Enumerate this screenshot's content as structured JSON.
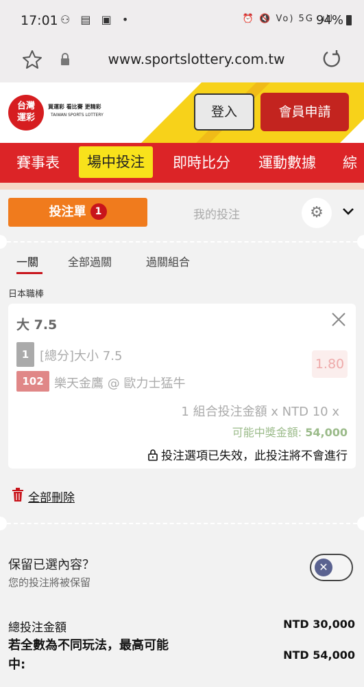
{
  "status_bar": {
    "time": "17:01",
    "left_icons": "⚇ ▤ ▣ •",
    "right_icons": "⏰ 🔇 Vo) 5G .ıll",
    "battery": "94%"
  },
  "browser": {
    "url": "www.sportslottery.com.tw"
  },
  "header": {
    "logo_text": "台灣\n運彩",
    "logo_tagline": "買運彩 看比賽 更精彩",
    "logo_en": "TAIWAN SPORTS LOTTERY",
    "login_label": "登入",
    "register_label": "會員申請",
    "colors": {
      "brand_red": "#dc2427",
      "yellow": "#f8e21b"
    }
  },
  "nav": {
    "items": [
      {
        "label": "賽事表"
      },
      {
        "label": "場中投注"
      },
      {
        "label": "即時比分"
      },
      {
        "label": "運動數據"
      },
      {
        "label": "綜"
      }
    ],
    "active_index": 1
  },
  "betslip": {
    "tab_bet_label": "投注單",
    "tab_bet_count": "1",
    "tab_my_label": "我的投注",
    "subtabs": [
      "一關",
      "全部過關",
      "過關組合"
    ],
    "active_subtab": 0,
    "league": "日本職棒",
    "card": {
      "title": "大 7.5",
      "selection_num": "1",
      "market": "[總分]大小 7.5",
      "odds": "1.80",
      "match_num": "102",
      "match": "樂天金鷹 @ 歐力士猛牛",
      "stake_text": "1 組合投注金額 x NTD 10 x",
      "payout_label": "可能中獎金額: ",
      "payout_value": "54,000",
      "invalid_text": "投注選項已失效，此投注將不會進行"
    },
    "delete_all": "全部刪除",
    "keep_title": "保留已選內容？",
    "keep_sub": "您的投注將被保留",
    "keep_enabled": false,
    "total_label": "總投注金額",
    "total_value": "NTD 30,000",
    "max_label": "若全數為不同玩法，最高可能中:",
    "max_value": "NTD 54,000"
  }
}
